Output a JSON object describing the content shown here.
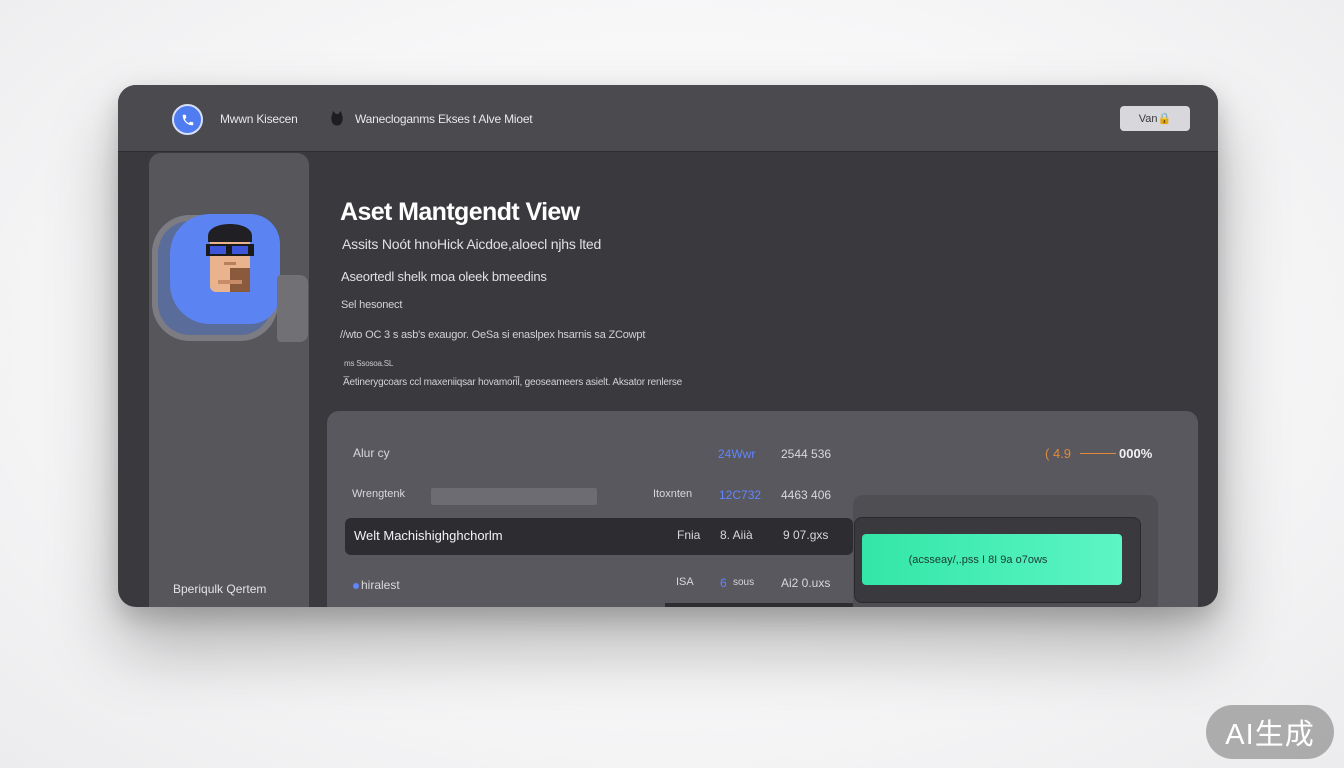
{
  "topbar": {
    "app_name": "Mwwn Kisecen",
    "breadcrumb": "Wanecloganms Ekses t Alve Mioet",
    "action_button": "Van🔒"
  },
  "sidebar": {
    "footer_label": "Bperiqulk Qertem"
  },
  "main": {
    "title": "Aset Mantgendt View",
    "lines": [
      "Assits Noót hnoHick Aicdoe,aloecl njhs lted",
      "Aseortedl shelk moa oleek bmeedins",
      "Sel hesonect",
      "//wto OC 3 s asb's exaugor. OeSa si enaslpex hsarnis sa ZCowpt",
      "ms Ssosoa.SL",
      "A̅etinerygcoars ccl maxeniiqsar hovamori̅l, geoseameers asielt. Aksator renlerse"
    ]
  },
  "table": {
    "row1": {
      "label": "Alur cy",
      "col1": "24Wwr",
      "col2": "2544 536",
      "accent": "( 4.9",
      "percent": "000%"
    },
    "row2": {
      "label": "Wrengtenk",
      "mid_label": "Itoxnten",
      "col1": "12C732",
      "col2": "4463 406"
    },
    "row3": {
      "label": "Welt Machishighghchorlm",
      "mid_label": "Fnia",
      "col1": "8. Aiià",
      "col2": "9 07.gxs"
    },
    "row4": {
      "label": "hiralest",
      "mid_label": "ISA",
      "col1": "6",
      "col1_suffix": "sous",
      "col2": "Ai2 0.uxs"
    }
  },
  "popup": {
    "button_label": "(acsseay/,.pss I 8I 9a o7ows"
  },
  "badge": "AI生成",
  "colors": {
    "accent_blue": "#5f86ff",
    "accent_orange": "#e08a3c",
    "cta_green": "#41edb2",
    "window_bg": "#3a3a3e"
  },
  "icons": [
    "phone-icon",
    "cat-icon",
    "lock-icon",
    "avatar-person"
  ]
}
